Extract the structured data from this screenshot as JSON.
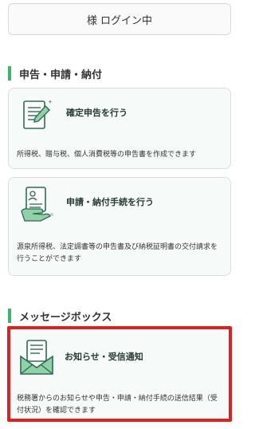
{
  "login": {
    "status_text": "様 ログイン中"
  },
  "sections": {
    "filing": {
      "title": "申告・申請・納付"
    },
    "messages": {
      "title": "メッセージボックス"
    }
  },
  "cards": {
    "tax_return": {
      "title": "確定申告を行う",
      "description": "所得税、贈与税、個人消費税等の申告書を作成できます",
      "icon": "document-pen-icon"
    },
    "application_payment": {
      "title": "申請・納付手続を行う",
      "description": "源泉所得税、法定調書等の申告書及び納税証明書の交付請求を行うことができます",
      "icon": "hand-document-icon"
    },
    "notifications": {
      "title": "お知らせ・受信通知",
      "description": "税務署からのお知らせや申告・申請・納付手続の送信結果（受付状況）を確認できます",
      "icon": "envelope-letter-icon"
    }
  },
  "colors": {
    "accent_green": "#3cb371",
    "highlight_red": "#e02020",
    "card_background": "#f6faf8"
  }
}
